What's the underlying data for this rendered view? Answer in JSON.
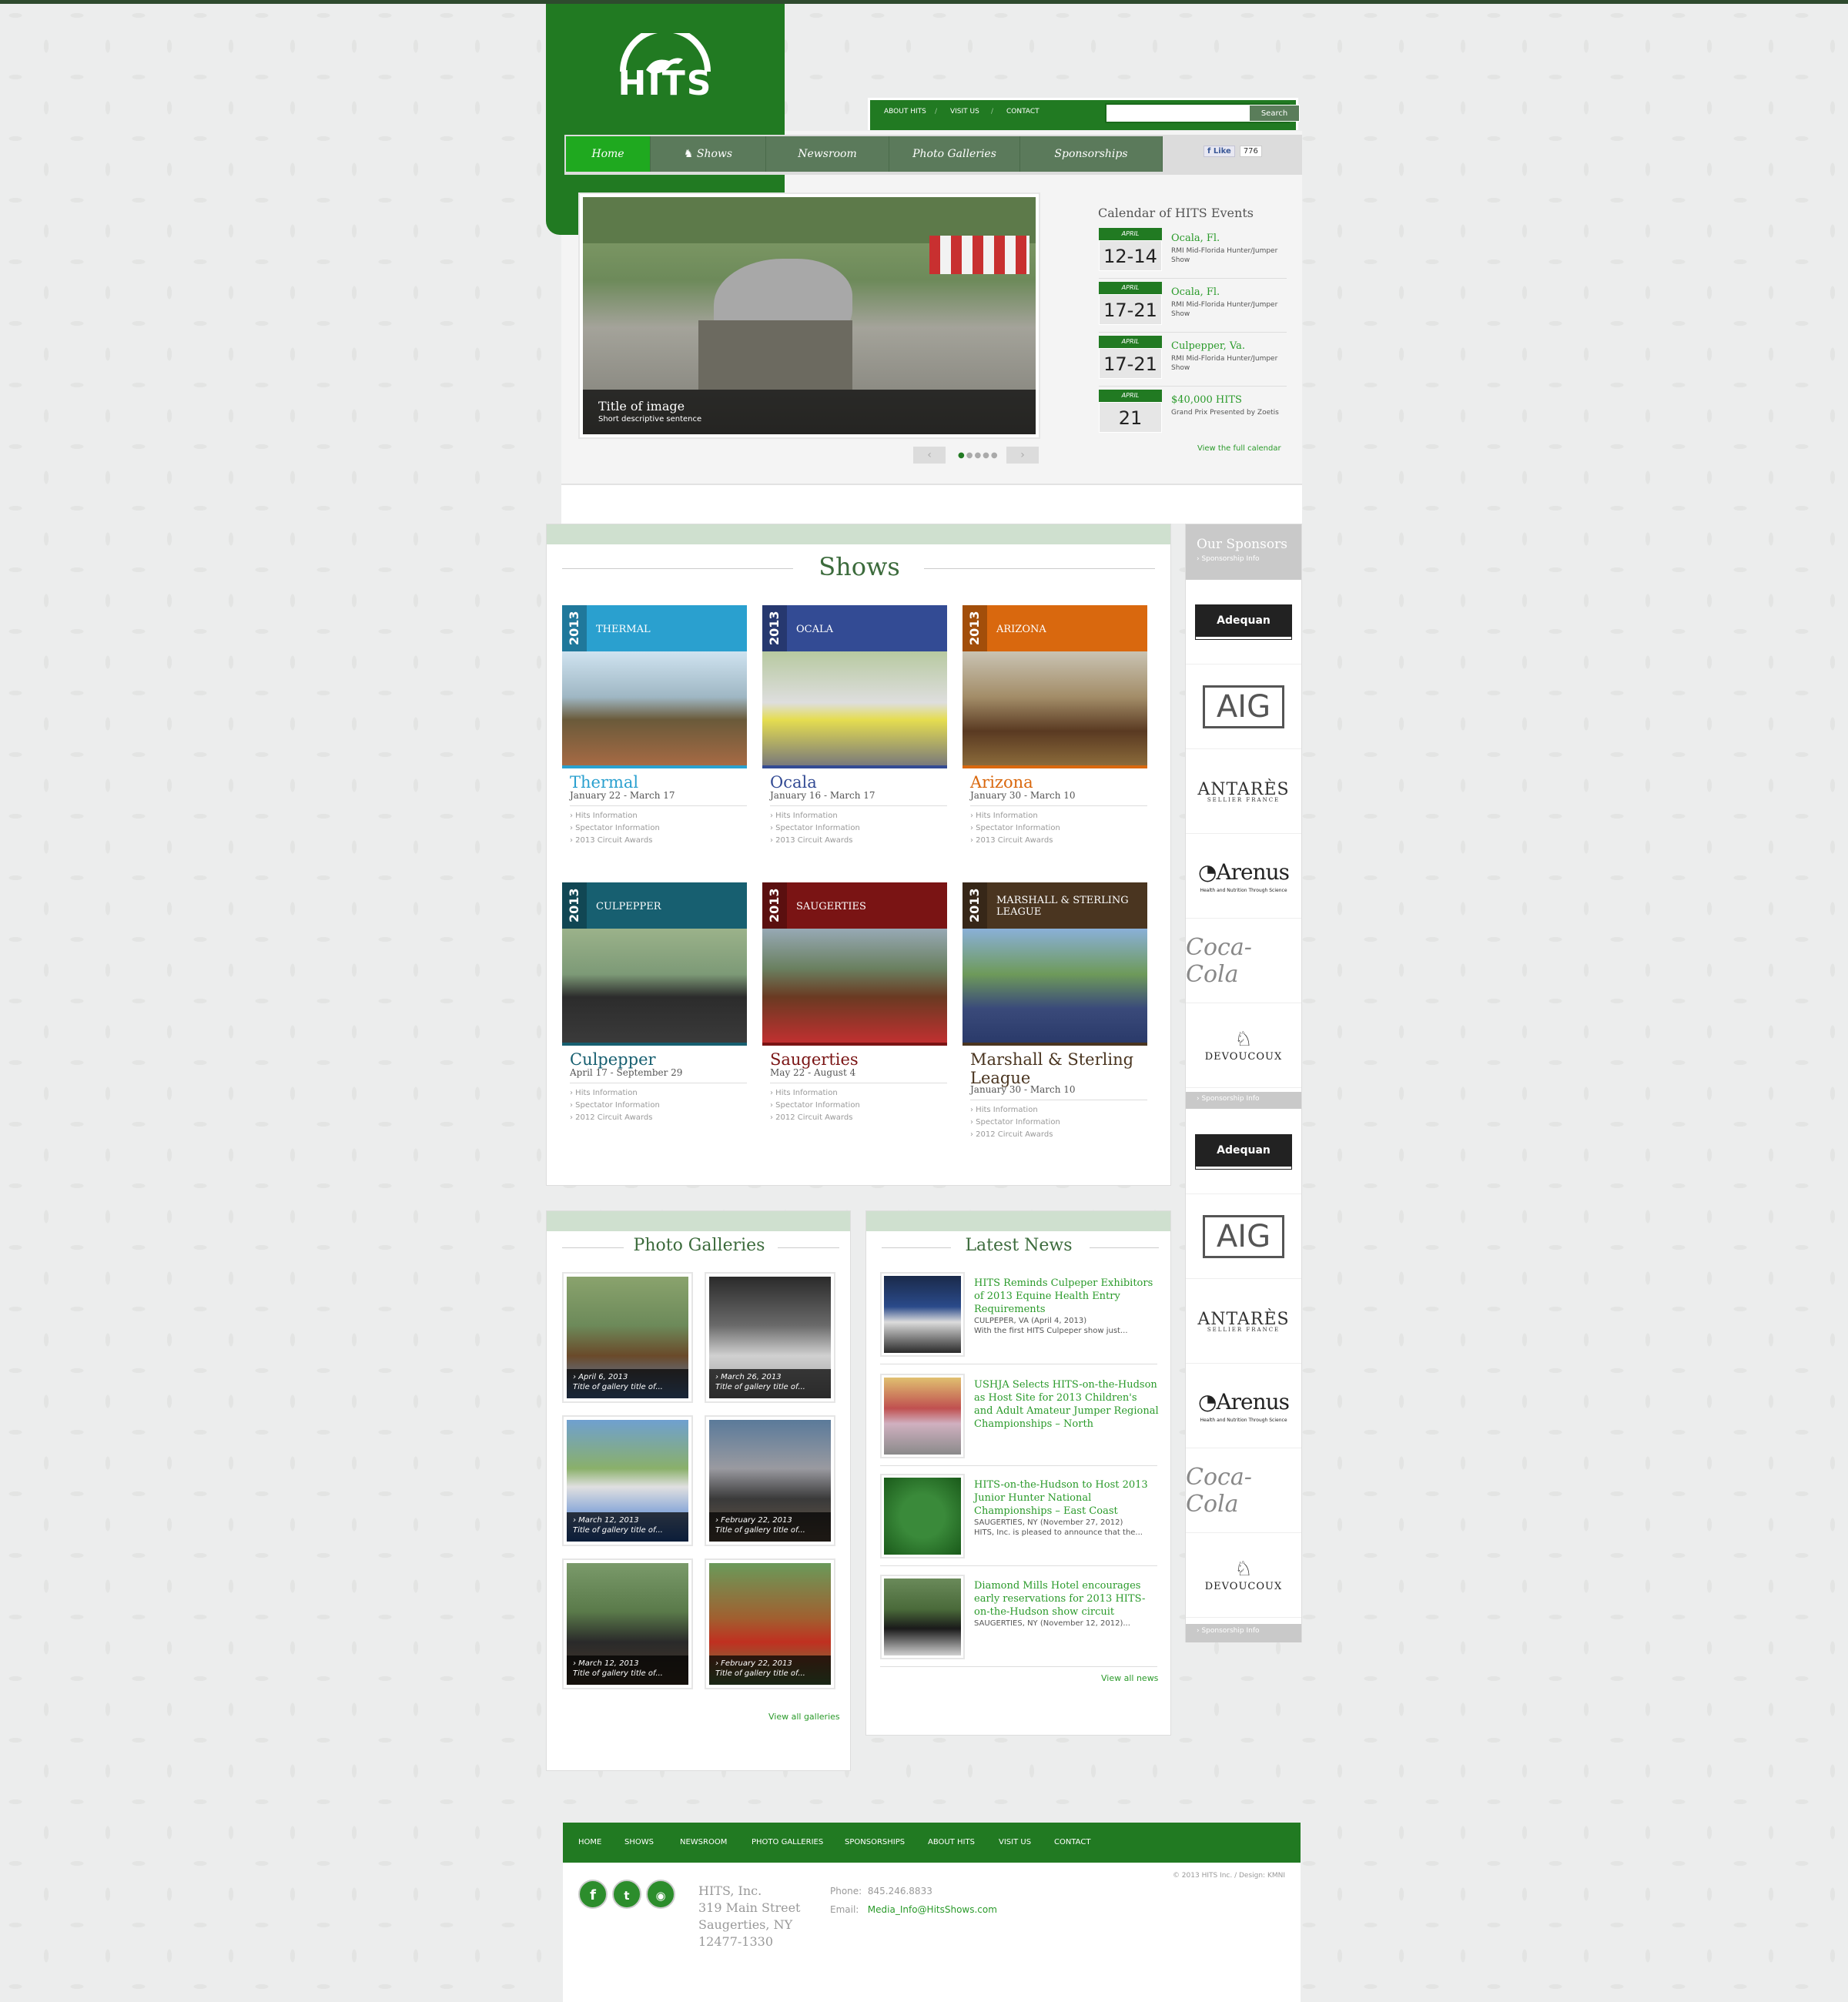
{
  "brand": {
    "logo_text": "HITS"
  },
  "utility": {
    "links": [
      "ABOUT HITS",
      "VISIT US",
      "CONTACT"
    ],
    "search_placeholder": "",
    "search_button": "Search"
  },
  "nav": {
    "items": [
      "Home",
      "Shows",
      "Newsroom",
      "Photo Galleries",
      "Sponsorships"
    ],
    "like": "Like",
    "like_count": "776"
  },
  "slider": {
    "title": "Title of image",
    "subtitle": "Short descriptive sentence",
    "prev": "‹",
    "next": "›"
  },
  "calendar": {
    "title": "Calendar of HITS Events",
    "events": [
      {
        "month": "APRIL",
        "day": "12-14",
        "place": "Ocala, Fl.",
        "desc": "RMI Mid-Florida Hunter/Jumper Show"
      },
      {
        "month": "APRIL",
        "day": "17-21",
        "place": "Ocala, Fl.",
        "desc": "RMI Mid-Florida Hunter/Jumper Show"
      },
      {
        "month": "APRIL",
        "day": "17-21",
        "place": "Culpepper, Va.",
        "desc": "RMI Mid-Florida Hunter/Jumper Show"
      },
      {
        "month": "APRIL",
        "day": "21",
        "place": "$40,000 HITS",
        "desc": "Grand Prix Presented by Zoetis"
      }
    ],
    "view_all": "View the full calendar"
  },
  "shows": {
    "title": "Shows",
    "items": [
      {
        "year": "2013",
        "tag": "THERMAL",
        "name": "Thermal",
        "dates": "January 22 - March 17",
        "links": [
          "Hits Information",
          "Spectator Information",
          "2013 Circuit Awards"
        ],
        "color": "#2aa0cf"
      },
      {
        "year": "2013",
        "tag": "OCALA",
        "name": "Ocala",
        "dates": "January 16 - March 17",
        "links": [
          "Hits Information",
          "Spectator Information",
          "2013 Circuit Awards"
        ],
        "color": "#334b94"
      },
      {
        "year": "2013",
        "tag": "ARIZONA",
        "name": "Arizona",
        "dates": "January 30 - March 10",
        "links": [
          "Hits Information",
          "Spectator Information",
          "2013 Circuit Awards"
        ],
        "color": "#d9680e"
      },
      {
        "year": "2013",
        "tag": "CULPEPPER",
        "name": "Culpepper",
        "dates": "April 17 - September 29",
        "links": [
          "Hits Information",
          "Spectator Information",
          "2012 Circuit Awards"
        ],
        "color": "#175f70"
      },
      {
        "year": "2013",
        "tag": "SAUGERTIES",
        "name": "Saugerties",
        "dates": "May 22 - August 4",
        "links": [
          "Hits Information",
          "Spectator Information",
          "2012 Circuit Awards"
        ],
        "color": "#7a1414"
      },
      {
        "year": "2013",
        "tag": "MARSHALL & STERLING LEAGUE",
        "name": "Marshall & Sterling League",
        "dates": "January 30 - March 10",
        "links": [
          "Hits Information",
          "Spectator Information",
          "2012 Circuit Awards"
        ],
        "color": "#4a3520"
      }
    ]
  },
  "sponsors": {
    "title": "Our Sponsors",
    "info": "› Sponsorship Info",
    "logos": [
      "Adequan",
      "AIG",
      "ANTARÈS",
      "Arenus",
      "Coca-Cola",
      "DEVOUCOUX"
    ],
    "antares_sub": "SELLIER FRANCE",
    "arenus_sub": "Health and Nutrition Through Science"
  },
  "galleries": {
    "title": "Photo Galleries",
    "items": [
      {
        "date": "April 6, 2013",
        "title": "Title of gallery title of..."
      },
      {
        "date": "March 26, 2013",
        "title": "Title of gallery title of..."
      },
      {
        "date": "March 12, 2013",
        "title": "Title of gallery title of..."
      },
      {
        "date": "February 22, 2013",
        "title": "Title of gallery title of..."
      },
      {
        "date": "March 12, 2013",
        "title": "Title of gallery title of..."
      },
      {
        "date": "February 22, 2013",
        "title": "Title of gallery title of..."
      }
    ],
    "view_all": "View all galleries"
  },
  "news": {
    "title": "Latest News",
    "items": [
      {
        "title": "HITS Reminds Culpeper Exhibitors of 2013 Equine Health Entry Requirements",
        "meta": "CULPEPER, VA (April 4, 2013)",
        "excerpt": "With the first HITS Culpeper show just..."
      },
      {
        "title": "USHJA Selects HITS-on-the-Hudson as Host Site for 2013 Children's and Adult Amateur Jumper Regional Championships – North",
        "meta": "",
        "excerpt": ""
      },
      {
        "title": "HITS-on-the-Hudson to Host 2013 Junior Hunter National Championships – East Coast",
        "meta": "SAUGERTIES, NY (November 27, 2012)",
        "excerpt": "HITS, Inc. is pleased to announce that the..."
      },
      {
        "title": "Diamond Mills Hotel encourages early reservations for 2013 HITS-on-the-Hudson show circuit",
        "meta": "SAUGERTIES, NY (November 12, 2012)...",
        "excerpt": ""
      }
    ],
    "view_all": "View all news"
  },
  "footer": {
    "nav": [
      "HOME",
      "SHOWS",
      "NEWSROOM",
      "PHOTO GALLERIES",
      "SPONSORSHIPS",
      "ABOUT HITS",
      "VISIT US",
      "CONTACT"
    ],
    "address": [
      "HITS, Inc.",
      "319 Main Street",
      "Saugerties, NY",
      "12477-1330"
    ],
    "phone_label": "Phone:",
    "phone": "845.246.8833",
    "email_label": "Email:",
    "email": "Media_Info@HitsShows.com",
    "copyright": "© 2013 HITS Inc.   /   Design: KMNI"
  },
  "colors": {
    "brand_green": "#217a22",
    "link_green": "#2a9a2a",
    "nav_gray_green": "#5b7a5b"
  }
}
